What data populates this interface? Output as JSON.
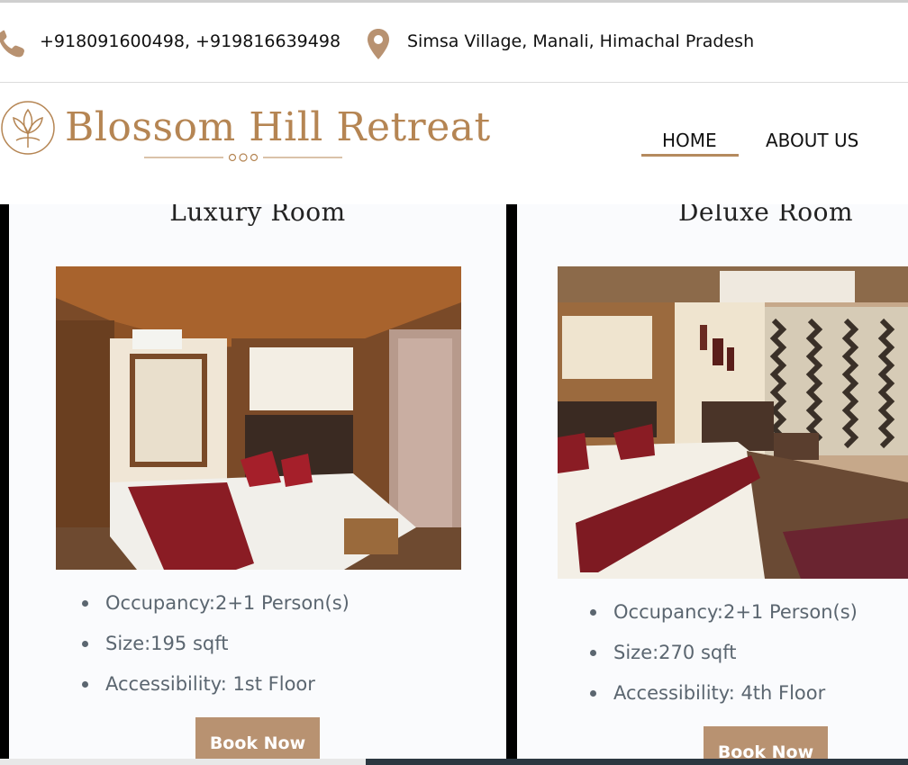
{
  "topbar": {
    "phone": "+918091600498, +919816639498",
    "address": "Simsa Village, Manali, Himachal Pradesh",
    "phone_icon": "phone-icon",
    "location_icon": "location-pin-icon"
  },
  "header": {
    "logo_text": "Blossom Hill Retreat",
    "nav": [
      "HOME",
      "ABOUT US"
    ],
    "active_nav": "HOME"
  },
  "rooms": [
    {
      "title": "Luxury Room",
      "features": [
        "Occupancy:2+1 Person(s)",
        "Size:195 sqft",
        "Accessibility: 1st Floor"
      ],
      "button": "Book Now"
    },
    {
      "title": "Deluxe Room",
      "features": [
        "Occupancy:2+1 Person(s)",
        "Size:270 sqft",
        "Accessibility: 4th Floor"
      ],
      "button": "Book Now"
    }
  ],
  "colors": {
    "brand": "#b58553",
    "button": "#b89271",
    "feature_text": "#5b6670"
  }
}
